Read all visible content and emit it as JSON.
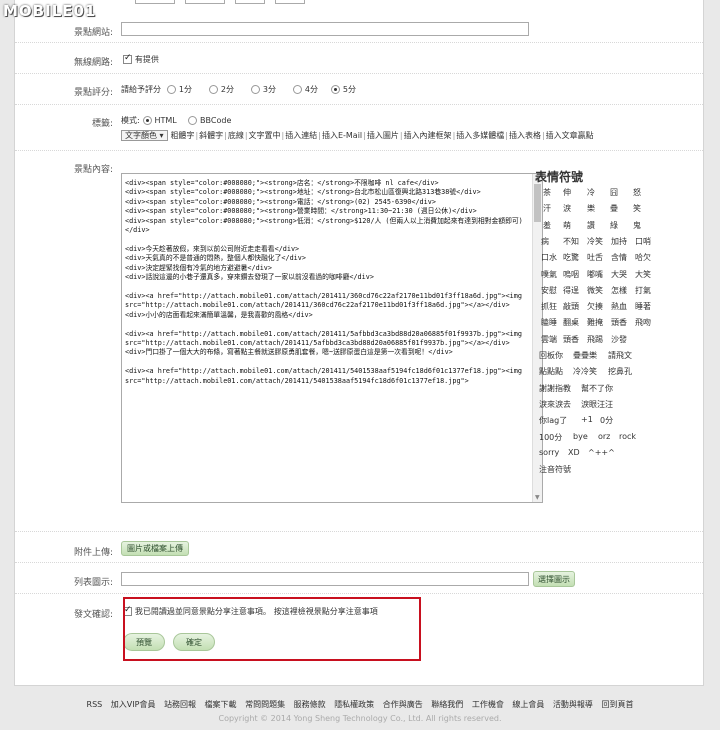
{
  "logo": "MOBILE01",
  "form": {
    "spot_site_label": "景點網站:",
    "wifi_label": "無線網路:",
    "wifi_option": "有提供",
    "rating_label": "景點評分:",
    "rating_prompt": "請給予評分",
    "rating_options": [
      "1分",
      "2分",
      "3分",
      "4分",
      "5分"
    ],
    "rating_selected": "5分",
    "mode_row_label": "標籤:",
    "mode_label": "模式:",
    "mode_options": [
      "HTML",
      "BBCode"
    ],
    "mode_selected": "HTML",
    "toolbar_select": "文字顏色",
    "toolbar_links": [
      "粗體字",
      "斜體字",
      "底線",
      "文字置中",
      "插入連結",
      "插入E-Mail",
      "插入圖片",
      "插入內建框架",
      "插入多媒體檔",
      "插入表格",
      "插入文章贏點"
    ],
    "content_label": "景點內容:",
    "content_code": "<div><span style=\"color:#008080;\"><strong>店名：</strong>不限咖啡 nl cafe</div>\n<div><span style=\"color:#008080;\"><strong>地址：</strong>台北市松山區復興北路313巷38號</div>\n<div><span style=\"color:#008080;\"><strong>電話：</strong>(02) 2545-6390</div>\n<div><span style=\"color:#008080;\"><strong>營業時間：</strong>11:30~21:30 (週日公休)</div>\n<div><span style=\"color:#008080;\"><strong>低消：</strong>$120/人 (但兩人以上消費加起來有達到相對金額即可)</div>\n\n<div>今天趁著放假，來到以前公司附近走走看看</div>\n<div>天氣真的不是普通的悶熱，整個人都快融化了</div>\n<div>決定趕緊找個有冷氣的地方避避暑</div>\n<div>話說這邊的小巷子還真多，穿來鑽去發現了一家以前沒看過的咖啡廳</div>\n\n<div><a href=\"http://attach.mobile01.com/attach/201411/360cd76c22af2170e11bd01f3ff18a6d.jpg\"><img src=\"http://attach.mobile01.com/attach/201411/360cd76c22af2170e11bd01f3ff18a6d.jpg\"></a></div>\n<div>小小的店面看起來滿簡單溫馨，是我喜歡的風格</div>\n\n<div><a href=\"http://attach.mobile01.com/attach/201411/5afbbd3ca3bd88d20a06885f01f9937b.jpg\"><img src=\"http://attach.mobile01.com/attach/201411/5afbbd3ca3bd88d20a06885f01f9937b.jpg\"></a></div>\n<div>門口掛了一個大大的布條，寫著點主餐就送膠原勇肌套餐，嗯~送膠原蛋白這是第一次看到呢！</div>\n\n<div><a href=\"http://attach.mobile01.com/attach/201411/5401538aaf5194fc18d6f01c1377ef18.jpg\"><img src=\"http://attach.mobile01.com/attach/201411/5401538aaf5194fc18d6f01c1377ef18.jpg\">",
    "emoji_title": "表情符號",
    "emoji_grid": [
      [
        "茶",
        "伸",
        "冷",
        "囧",
        "怒"
      ],
      [
        "汗",
        "淚",
        "樂",
        "疊",
        "笑"
      ],
      [
        "羞",
        "萌",
        "讚",
        "綠",
        "鬼"
      ],
      [
        "病",
        "不知",
        "冷笑",
        "加持",
        "口哨"
      ],
      [
        "口水",
        "吃驚",
        "吐舌",
        "含情",
        "哈欠"
      ],
      [
        "噗氣",
        "嗚咽",
        "嘟嘴",
        "大哭",
        "大笑"
      ],
      [
        "安慰",
        "得逞",
        "微笑",
        "怎樣",
        "打氣"
      ],
      [
        "抓狂",
        "敲頭",
        "欠揍",
        "熱血",
        "睡著"
      ],
      [
        "瞌睡",
        "翻桌",
        "難掩",
        "頭香",
        "飛吻"
      ],
      [
        "雲端",
        "頭香",
        "飛踢",
        "沙發"
      ]
    ],
    "emoji_phrases": [
      [
        "回板你",
        "疊疊樂",
        "請飛文"
      ],
      [
        "點點點",
        "冷冷笑",
        "挖鼻孔"
      ],
      [
        "謝謝指教",
        "幫不了你"
      ],
      [
        "淚來淚去",
        "淚眼汪汪"
      ],
      [
        "你lag了",
        "+1",
        "0分"
      ],
      [
        "100分",
        "bye",
        "orz",
        "rock"
      ],
      [
        "sorry",
        "XD",
        "^++^"
      ],
      [
        "注音符號"
      ]
    ],
    "upload_label": "附件上傳:",
    "upload_button": "圖片或檔案上傳",
    "list_image_label": "列表圖示:",
    "list_image_button": "選擇圖示",
    "confirm_label": "發文確認:",
    "confirm_text": "我已閱讀過並同意景點分享注意事項。",
    "confirm_link": "按這裡檢視景點分享注意事項",
    "preview_button": "預覽",
    "submit_button": "確定"
  },
  "footer": {
    "links": [
      "RSS",
      "加入VIP會員",
      "站務回報",
      "檔案下載",
      "常問問題集",
      "服務條款",
      "隱私權政策",
      "合作與廣告",
      "聯絡我們",
      "工作機會",
      "線上會員",
      "活動與報導",
      "回到頁首"
    ],
    "copyright": "Copyright © 2014 Yong Sheng Technology Co., Ltd. All rights reserved."
  },
  "colors": {
    "accent_red": "#c8101f",
    "button_green": "#c3dfb3"
  }
}
